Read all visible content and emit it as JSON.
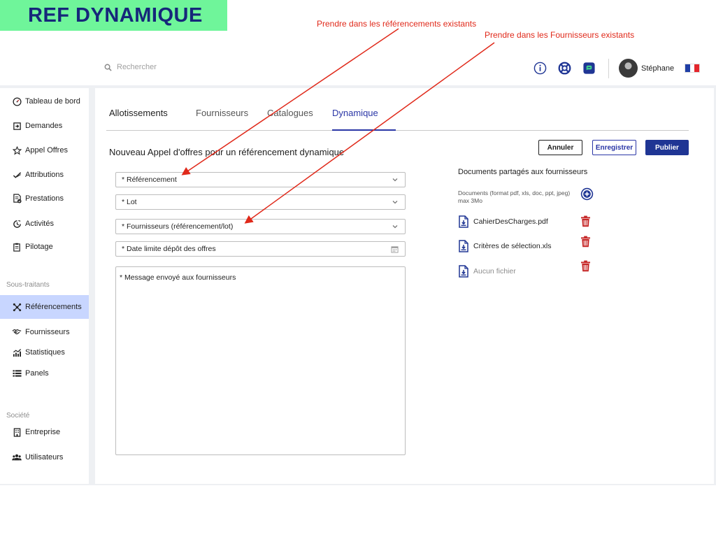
{
  "banner": {
    "title": "REF DYNAMIQUE",
    "bg_color": "#6ff59a",
    "text_color": "#16277a"
  },
  "annotations": [
    {
      "text": "Prendre dans les référencements existants"
    },
    {
      "text": "Prendre dans les Fournisseurs existants"
    }
  ],
  "annotation_color": "#e0291a",
  "header": {
    "search_placeholder": "Rechercher",
    "icons": [
      "info-icon",
      "lifebuoy-icon",
      "chat-icon"
    ],
    "user_name": "Stéphane",
    "language_flag": "fr-flag-icon"
  },
  "sidebar": {
    "items": [
      {
        "label": "Tableau de bord",
        "icon": "dashboard-icon"
      },
      {
        "label": "Demandes",
        "icon": "inbox-icon"
      },
      {
        "label": "Appel Offres",
        "icon": "star-icon"
      },
      {
        "label": "Attributions",
        "icon": "check-icon"
      },
      {
        "label": "Prestations",
        "icon": "document-check-icon"
      },
      {
        "label": "Activités",
        "icon": "activity-icon"
      },
      {
        "label": "Pilotage",
        "icon": "clipboard-icon"
      }
    ],
    "section_subcontractors": "Sous-traitants",
    "sub_items": [
      {
        "label": "Référencements",
        "icon": "network-icon",
        "active": true
      },
      {
        "label": "Fournisseurs",
        "icon": "handshake-icon"
      },
      {
        "label": "Statistiques",
        "icon": "stats-icon"
      },
      {
        "label": "Panels",
        "icon": "list-icon"
      }
    ],
    "section_company": "Société",
    "company_items": [
      {
        "label": "Entreprise",
        "icon": "building-icon"
      },
      {
        "label": "Utilisateurs",
        "icon": "users-icon"
      }
    ],
    "active_color": "#c8d6ff"
  },
  "tabs": [
    {
      "label": "Allotissements"
    },
    {
      "label": "Fournisseurs"
    },
    {
      "label": "Catalogues"
    },
    {
      "label": "Dynamique",
      "active": true
    }
  ],
  "form": {
    "title": "Nouveau Appel d'offres pour un référencement dynamique",
    "buttons": {
      "cancel": "Annuler",
      "save": "Enregistrer",
      "publish": "Publier"
    },
    "fields": {
      "referencement": "* Référencement",
      "lot": "* Lot",
      "fournisseurs": "* Fournisseurs (référencement/lot)",
      "date_limite": "* Date limite dépôt des offres",
      "message": "* Message envoyé aux fournisseurs"
    }
  },
  "documents": {
    "title": "Documents partagés aux fournisseurs",
    "note": "Documents (format pdf, xls, doc, ppt, jpeg) max 3Mo",
    "files": [
      {
        "name": "CahierDesCharges.pdf"
      },
      {
        "name": "Critères de sélection.xls"
      },
      {
        "name": "Aucun fichier",
        "empty": true
      }
    ]
  },
  "colors": {
    "primary": "#1f3594",
    "accent": "#2a36a6",
    "danger": "#c62828"
  }
}
